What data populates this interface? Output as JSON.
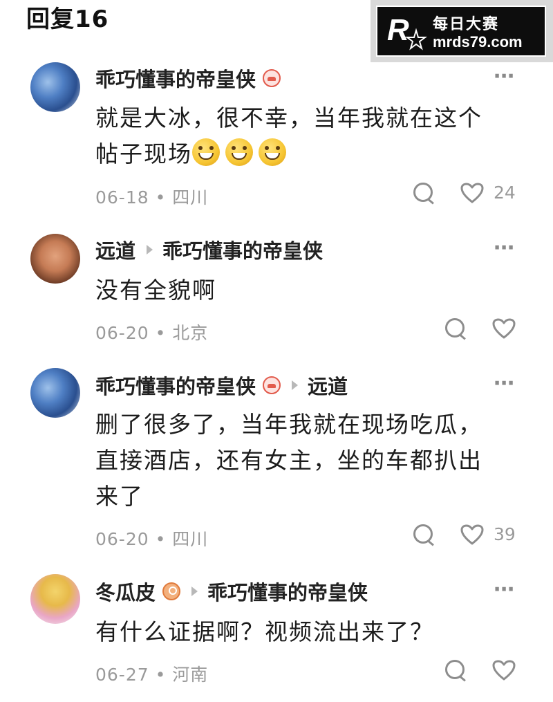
{
  "header": {
    "title": "回复16"
  },
  "watermark": {
    "line1": "每日大赛",
    "line2": "mrds79.com"
  },
  "comments": [
    {
      "user": "乖巧懂事的帝皇侠",
      "user_badge_icon": "car-badge-icon",
      "reply_to": "",
      "text_line1": "就是大冰，很不幸，当年我就在这个",
      "text_line2": "帖子现场",
      "emoji_icon": "grinning-face-icon",
      "emoji_count": 3,
      "date_location": "06-18 • 四川",
      "likes": "24"
    },
    {
      "user": "远道",
      "reply_to": "乖巧懂事的帝皇侠",
      "text": "没有全貌啊",
      "date_location": "06-20 • 北京",
      "likes": ""
    },
    {
      "user": "乖巧懂事的帝皇侠",
      "user_badge_icon": "car-badge-icon",
      "reply_to": "远道",
      "text_line1": "删了很多了，当年我就在现场吃瓜，",
      "text_line2": "直接酒店，还有女主，坐的车都扒出",
      "text_line3": "来了",
      "date_location": "06-20 • 四川",
      "likes": "39"
    },
    {
      "user": "冬瓜皮",
      "user_badge_icon": "user-badge-icon",
      "reply_to": "乖巧懂事的帝皇侠",
      "text": "有什么证据啊？视频流出来了？",
      "date_location": "06-27 • 河南",
      "likes": ""
    }
  ],
  "more_icon": "⋯"
}
